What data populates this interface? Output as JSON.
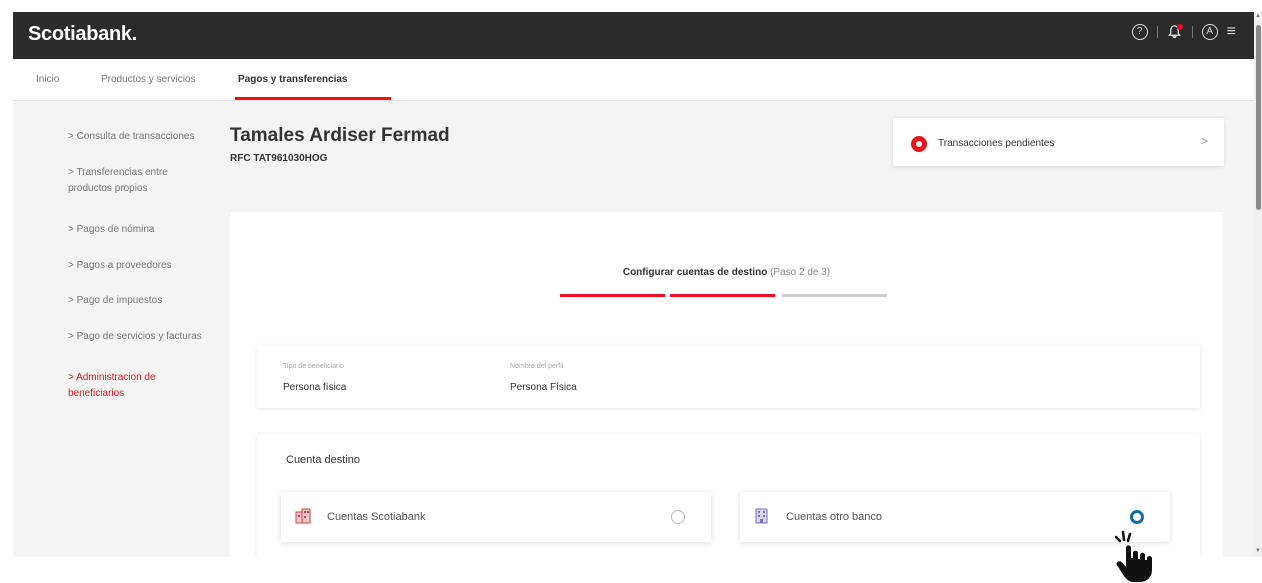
{
  "app": {
    "brand": "Scotiabank.",
    "help_icon_glyph": "?",
    "profile_icon_glyph": "A",
    "menu_icon_glyph": "≡"
  },
  "nav": {
    "items": [
      {
        "label": "Inicio"
      },
      {
        "label": "Productos y servicios"
      },
      {
        "label": "Pagos y transferencias"
      }
    ]
  },
  "sidebar": {
    "items": [
      {
        "label": "> Consulta de transacciones"
      },
      {
        "label": "> Transferencias entre productos propios"
      },
      {
        "label": "> Pagos de nómina"
      },
      {
        "label": "> Pagos a proveedores"
      },
      {
        "label": "> Pago de impuestos"
      },
      {
        "label": "> Pago de servicios y facturas"
      },
      {
        "label": "> Administracion de beneficiarios"
      }
    ]
  },
  "beneficiary": {
    "name": "Tamales Ardiser Fermad",
    "rfc": "RFC TAT961030HOG"
  },
  "pending": {
    "label": "Transacciones pendientes",
    "chevron": ">"
  },
  "step": {
    "title": "Configurar cuentas de destino",
    "count": "(Paso 2 de 3)",
    "current": 2,
    "total": 3
  },
  "info": {
    "type_label": "Tipo de beneficiario",
    "type_value": "Persona física",
    "name_label": "Nombre del perfil",
    "name_value": "Persona Física"
  },
  "destination": {
    "title": "Cuenta destino",
    "options": [
      {
        "label": "Cuentas Scotiabank",
        "icon": "building-icon",
        "selected": false
      },
      {
        "label": "Cuentas otro banco",
        "icon": "bank-icon",
        "selected": true
      }
    ]
  },
  "colors": {
    "brand_red": "#ec111a",
    "topbar": "#2b2b2b",
    "radio_selected": "#0a6ea6"
  }
}
